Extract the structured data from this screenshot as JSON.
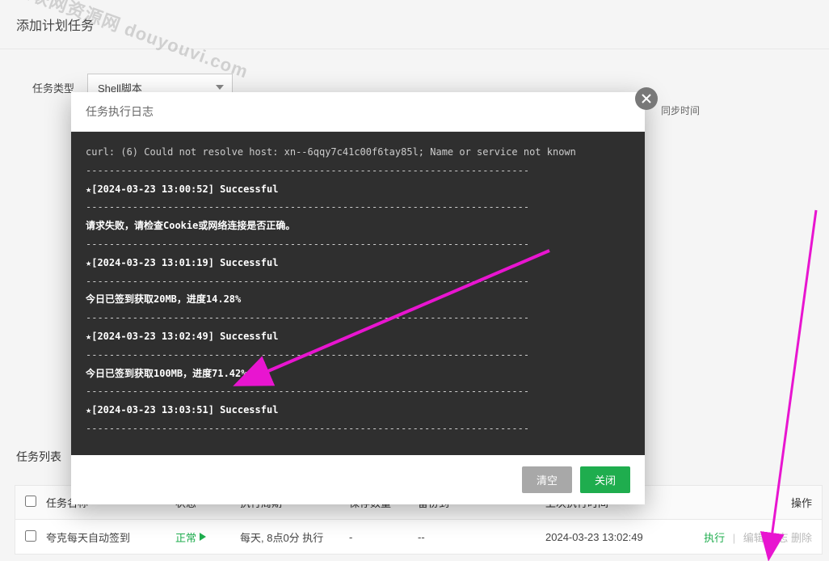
{
  "page_title": "添加计划任务",
  "form": {
    "task_type_label": "任务类型",
    "task_type_value": "Shell脚本"
  },
  "sync_time_label": "同步时间",
  "watermark": "互联网资源网\ndouyouvi.com",
  "modal": {
    "title": "任务执行日志",
    "log_lines": [
      {
        "text": "curl: (6) Could not resolve host: xn--6qqy7c41c00f6tay85l; Name or service not known",
        "bold": false
      },
      {
        "text": "----------------------------------------------------------------------------",
        "bold": false
      },
      {
        "text": "★[2024-03-23 13:00:52] Successful",
        "bold": true
      },
      {
        "text": "----------------------------------------------------------------------------",
        "bold": false
      },
      {
        "text": "请求失败，请检查Cookie或网络连接是否正确。",
        "bold": true
      },
      {
        "text": "----------------------------------------------------------------------------",
        "bold": false
      },
      {
        "text": "★[2024-03-23 13:01:19] Successful",
        "bold": true
      },
      {
        "text": "----------------------------------------------------------------------------",
        "bold": false
      },
      {
        "text": "今日已签到获取20MB，进度14.28%",
        "bold": true
      },
      {
        "text": "----------------------------------------------------------------------------",
        "bold": false
      },
      {
        "text": "★[2024-03-23 13:02:49] Successful",
        "bold": true
      },
      {
        "text": "----------------------------------------------------------------------------",
        "bold": false
      },
      {
        "text": "今日已签到获取100MB，进度71.42%",
        "bold": true
      },
      {
        "text": "----------------------------------------------------------------------------",
        "bold": false
      },
      {
        "text": "★[2024-03-23 13:03:51] Successful",
        "bold": true
      },
      {
        "text": "----------------------------------------------------------------------------",
        "bold": false
      }
    ],
    "btn_clear": "清空",
    "btn_close": "关闭"
  },
  "task_list_label": "任务列表",
  "table": {
    "headers": {
      "name": "任务名称",
      "status": "状态",
      "cycle": "执行周期",
      "keep": "保存数量",
      "backup": "备份到",
      "lasttime": "上次执行时间",
      "ops": "操作"
    },
    "rows": [
      {
        "name": "夸克每天自动签到",
        "status": "正常",
        "cycle": "每天, 8点0分 执行",
        "keep": "-",
        "backup": "--",
        "lasttime": "2024-03-23 13:02:49",
        "op_exec": "执行",
        "op_other": "编辑  日志  删除"
      }
    ]
  }
}
